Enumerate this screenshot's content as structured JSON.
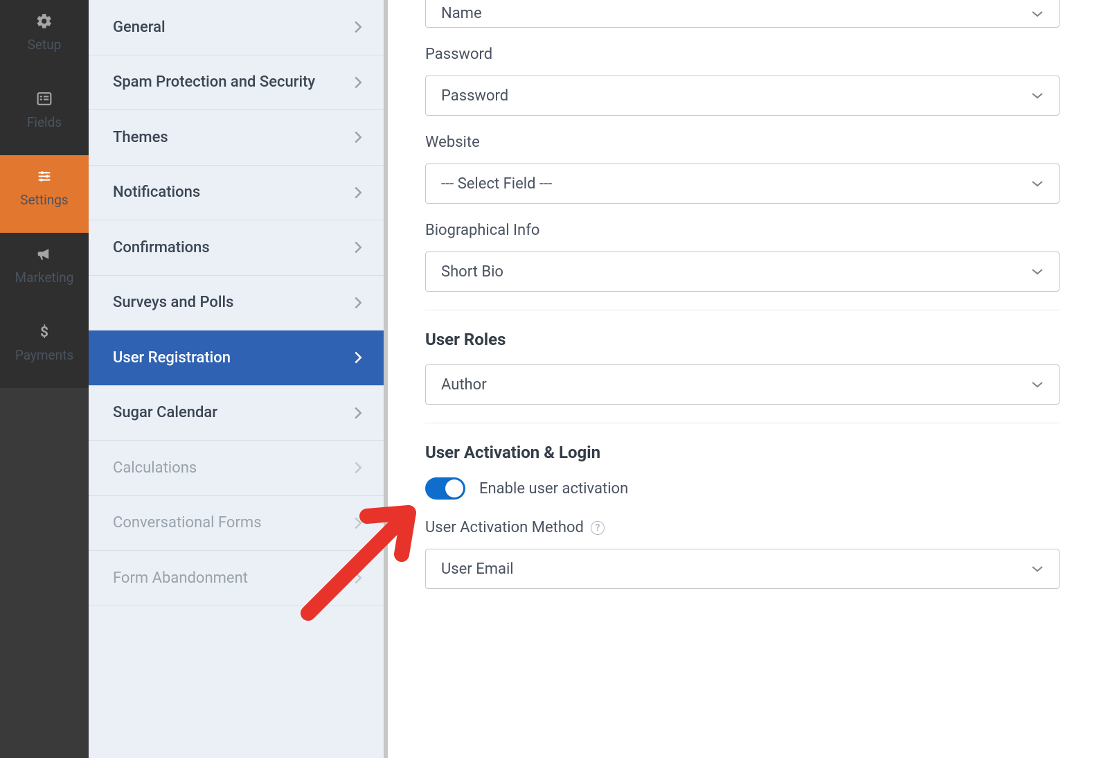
{
  "rail": {
    "items": [
      {
        "label": "Setup"
      },
      {
        "label": "Fields"
      },
      {
        "label": "Settings"
      },
      {
        "label": "Marketing"
      },
      {
        "label": "Payments"
      }
    ]
  },
  "submenu": {
    "items": [
      {
        "label": "General"
      },
      {
        "label": "Spam Protection and Security"
      },
      {
        "label": "Themes"
      },
      {
        "label": "Notifications"
      },
      {
        "label": "Confirmations"
      },
      {
        "label": "Surveys and Polls"
      },
      {
        "label": "User Registration"
      },
      {
        "label": "Sugar Calendar"
      },
      {
        "label": "Calculations"
      },
      {
        "label": "Conversational Forms"
      },
      {
        "label": "Form Abandonment"
      }
    ]
  },
  "main": {
    "name_field": {
      "value": "Name"
    },
    "password_field": {
      "label": "Password",
      "value": "Password"
    },
    "website_field": {
      "label": "Website",
      "value": "--- Select Field ---"
    },
    "bio_field": {
      "label": "Biographical Info",
      "value": "Short Bio"
    },
    "user_roles": {
      "title": "User Roles",
      "value": "Author"
    },
    "activation": {
      "title": "User Activation & Login",
      "toggle_label": "Enable user activation",
      "toggle_on": true,
      "method_label": "User Activation Method",
      "method_value": "User Email"
    }
  }
}
